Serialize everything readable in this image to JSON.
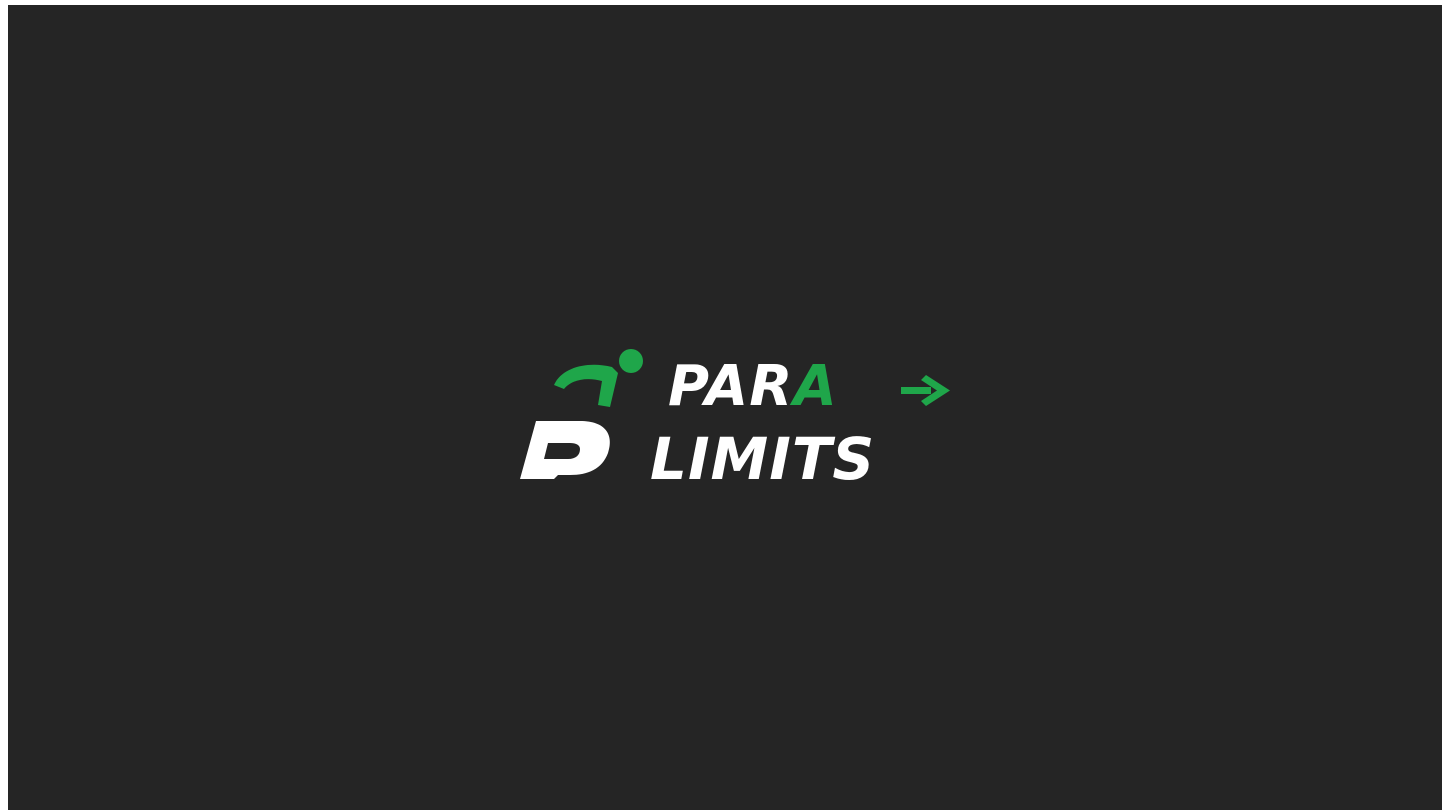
{
  "app": {
    "splash": {
      "logo": {
        "line1_part1": "PAR",
        "line1_part2": "A",
        "line2": "LIMITS",
        "icon": "para-athlete-p-icon",
        "arrow_icon": "right-arrow-icon"
      }
    }
  },
  "colors": {
    "background": "#252525",
    "brand_green": "#1fa64a",
    "text_white": "#ffffff"
  }
}
